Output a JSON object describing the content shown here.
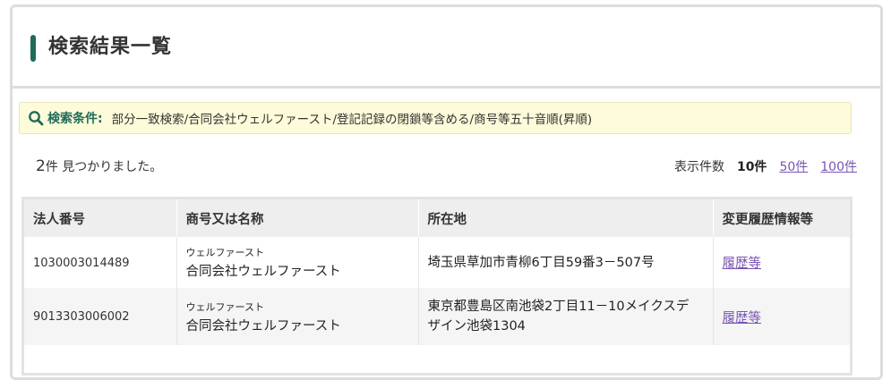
{
  "page": {
    "title": "検索結果一覧"
  },
  "conditions": {
    "label": "検索条件:",
    "text": "部分一致検索/合同会社ウェルファースト/登記記録の閉鎖等含める/商号等五十音順(昇順)",
    "icon": "search-icon"
  },
  "results": {
    "count": "2",
    "count_suffix": "件 見つかりました。"
  },
  "per_page": {
    "label": "表示件数",
    "current": "10件",
    "options": [
      "50件",
      "100件"
    ]
  },
  "table": {
    "headers": [
      "法人番号",
      "商号又は名称",
      "所在地",
      "変更履歴情報等"
    ],
    "rows": [
      {
        "corp_number": "1030003014489",
        "kana": "ウェルファースト",
        "name": "合同会社ウェルファースト",
        "address": "埼玉県草加市青柳6丁目59番3－507号",
        "history": "履歴等"
      },
      {
        "corp_number": "9013303006002",
        "kana": "ウェルファースト",
        "name": "合同会社ウェルファースト",
        "address": "東京都豊島区南池袋2丁目11－10メイクスデザイン池袋1304",
        "history": "履歴等"
      }
    ]
  },
  "colors": {
    "accent": "#1f6b5a",
    "link": "#7a55b3",
    "conditions_bg": "#fdfbd9"
  }
}
